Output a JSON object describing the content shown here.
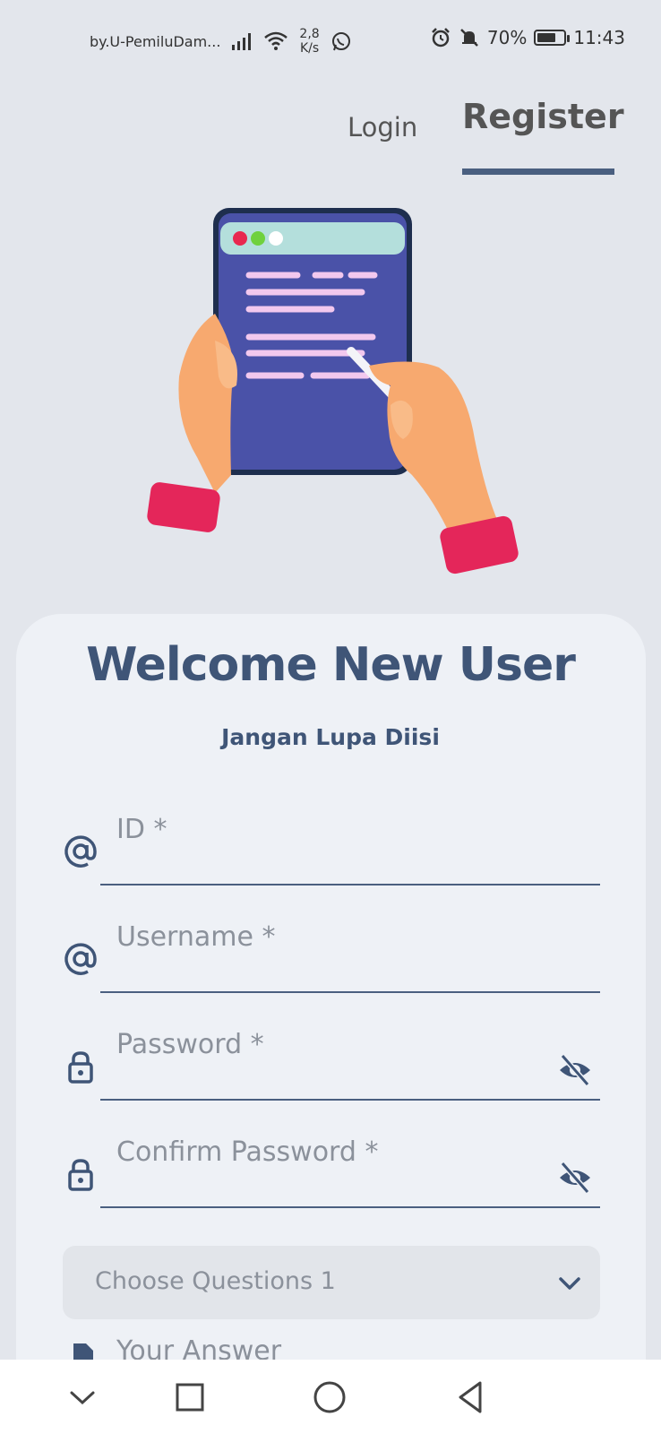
{
  "status_bar": {
    "carrier": "by.U-PemiluDam...",
    "net_speed_value": "2,8",
    "net_speed_unit": "K/s",
    "battery_percent": "70%",
    "battery_level": 0.7,
    "time": "11:43"
  },
  "tabs": {
    "login": "Login",
    "register": "Register",
    "active": "register"
  },
  "header": {
    "title": "Welcome New User",
    "subtitle": "Jangan Lupa Diisi"
  },
  "form": {
    "id_label": "ID *",
    "username_label": "Username *",
    "password_label": "Password *",
    "confirm_password_label": "Confirm Password *",
    "question_select": "Choose Questions 1",
    "answer_label": "Your Answer"
  },
  "colors": {
    "accent": "#4a5f80",
    "background": "#e3e6ec",
    "card": "#eef1f6"
  }
}
